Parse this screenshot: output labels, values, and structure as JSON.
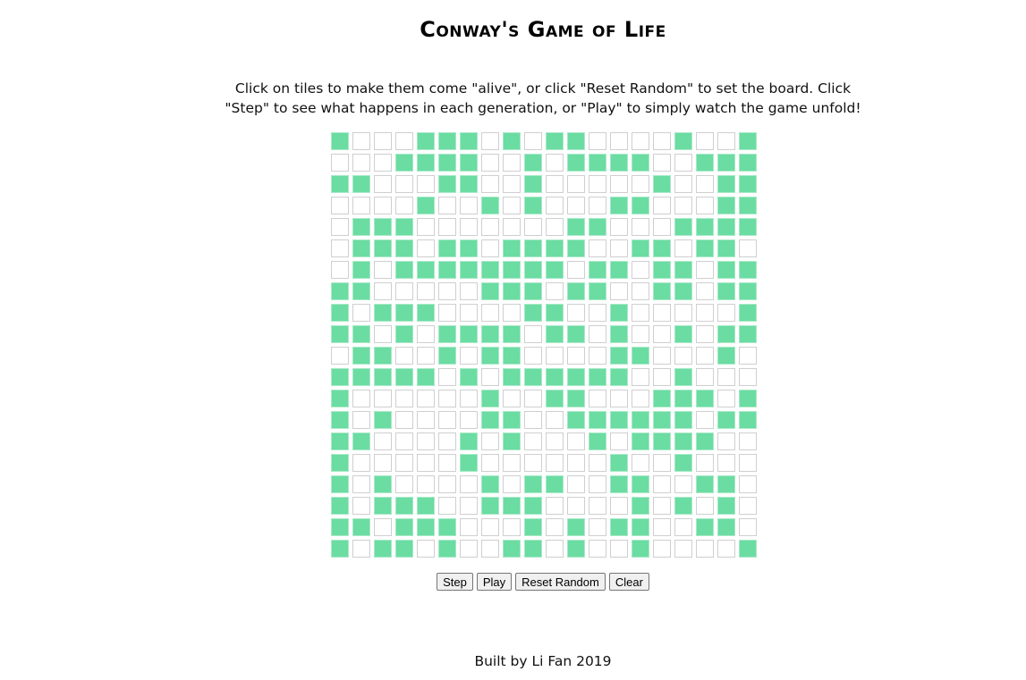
{
  "title": "Conway's Game of Life",
  "instructions": "Click on tiles to make them come \"alive\", or click \"Reset Random\" to set the board. Click \"Step\" to see what happens in each generation, or \"Play\" to simply watch the game unfold!",
  "colors": {
    "alive": "#6bdca2",
    "dead": "#ffffff",
    "cell_border": "#cfcfcf"
  },
  "board": {
    "rows": 20,
    "cols": 20,
    "grid": [
      "10001110101100001001",
      "00011110010111100111",
      "11000110010000010011",
      "00001001010001100011",
      "01110000000110001111",
      "01110110111100110110",
      "01011111111011011011",
      "11000001110110011011",
      "10111000011001000001",
      "11010111101101001011",
      "01100101100001100010",
      "11111010111111001000",
      "10000001001100011101",
      "10100001100111111011",
      "11000010100010111100",
      "10000010000001001000",
      "10100001011001100110",
      "10111001110000101010",
      "11011100010101100110",
      "10110100110100100001"
    ]
  },
  "buttons": {
    "step": "Step",
    "play": "Play",
    "reset_random": "Reset Random",
    "clear": "Clear"
  },
  "footer": "Built by Li Fan 2019"
}
